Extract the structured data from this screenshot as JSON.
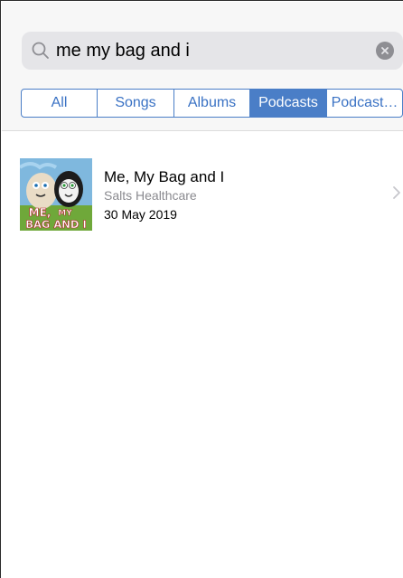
{
  "search": {
    "value": "me my bag and i",
    "icons": {
      "search": "magnifier-icon",
      "clear": "clear-circle-icon"
    }
  },
  "segments": [
    {
      "label": "All",
      "selected": false
    },
    {
      "label": "Songs",
      "selected": false
    },
    {
      "label": "Albums",
      "selected": false
    },
    {
      "label": "Podcasts",
      "selected": true
    },
    {
      "label": "Podcast…",
      "selected": false
    }
  ],
  "results": [
    {
      "title": "Me, My Bag and I",
      "subtitle": "Salts Healthcare",
      "date": "30 May 2019",
      "artwork_text": "ME, MY BAG AND I"
    }
  ],
  "colors": {
    "accent": "#4a7ec7",
    "search_bg": "#e5e5e8",
    "secondary_text": "#8a8a8f"
  }
}
